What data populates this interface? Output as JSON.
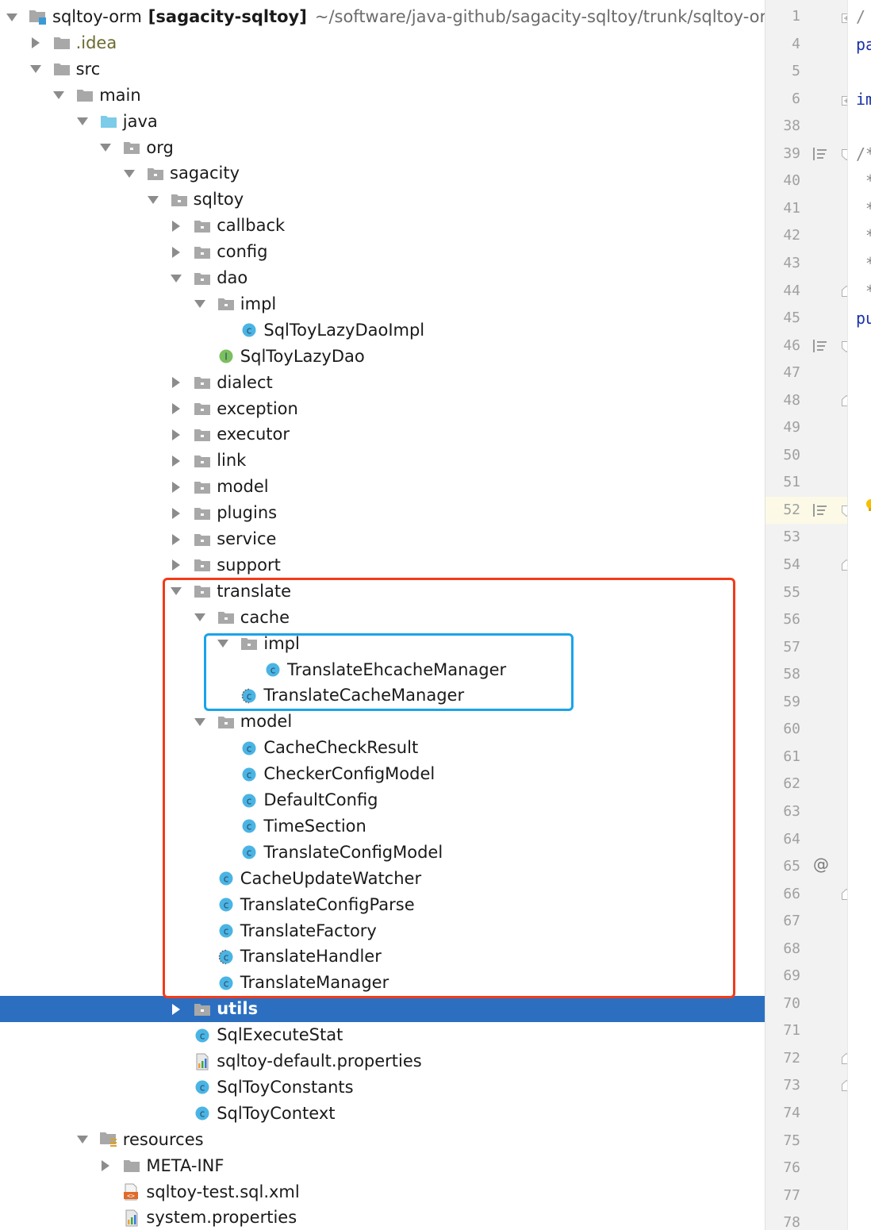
{
  "project": {
    "name": "sqltoy-orm",
    "module": "[sagacity-sqltoy]",
    "path": "~/software/java-github/sagacity-sqltoy/trunk/sqltoy-orm"
  },
  "tree": [
    {
      "label": "sqltoy-orm",
      "level": 0,
      "arrow": "down",
      "icon": "module-folder",
      "root": true
    },
    {
      "label": ".idea",
      "level": 1,
      "arrow": "right",
      "icon": "folder",
      "style": "idea"
    },
    {
      "label": "src",
      "level": 1,
      "arrow": "down",
      "icon": "folder"
    },
    {
      "label": "main",
      "level": 2,
      "arrow": "down",
      "icon": "folder"
    },
    {
      "label": "java",
      "level": 3,
      "arrow": "down",
      "icon": "source-folder"
    },
    {
      "label": "org",
      "level": 4,
      "arrow": "down",
      "icon": "package"
    },
    {
      "label": "sagacity",
      "level": 5,
      "arrow": "down",
      "icon": "package"
    },
    {
      "label": "sqltoy",
      "level": 6,
      "arrow": "down",
      "icon": "package"
    },
    {
      "label": "callback",
      "level": 7,
      "arrow": "right",
      "icon": "package"
    },
    {
      "label": "config",
      "level": 7,
      "arrow": "right",
      "icon": "package"
    },
    {
      "label": "dao",
      "level": 7,
      "arrow": "down",
      "icon": "package"
    },
    {
      "label": "impl",
      "level": 8,
      "arrow": "down",
      "icon": "package"
    },
    {
      "label": "SqlToyLazyDaoImpl",
      "level": 9,
      "arrow": "none",
      "icon": "class"
    },
    {
      "label": "SqlToyLazyDao",
      "level": 8,
      "arrow": "none",
      "icon": "interface"
    },
    {
      "label": "dialect",
      "level": 7,
      "arrow": "right",
      "icon": "package"
    },
    {
      "label": "exception",
      "level": 7,
      "arrow": "right",
      "icon": "package"
    },
    {
      "label": "executor",
      "level": 7,
      "arrow": "right",
      "icon": "package"
    },
    {
      "label": "link",
      "level": 7,
      "arrow": "right",
      "icon": "package"
    },
    {
      "label": "model",
      "level": 7,
      "arrow": "right",
      "icon": "package"
    },
    {
      "label": "plugins",
      "level": 7,
      "arrow": "right",
      "icon": "package"
    },
    {
      "label": "service",
      "level": 7,
      "arrow": "right",
      "icon": "package"
    },
    {
      "label": "support",
      "level": 7,
      "arrow": "right",
      "icon": "package"
    },
    {
      "label": "translate",
      "level": 7,
      "arrow": "down",
      "icon": "package"
    },
    {
      "label": "cache",
      "level": 8,
      "arrow": "down",
      "icon": "package"
    },
    {
      "label": "impl",
      "level": 9,
      "arrow": "down",
      "icon": "package"
    },
    {
      "label": "TranslateEhcacheManager",
      "level": 10,
      "arrow": "none",
      "icon": "class"
    },
    {
      "label": "TranslateCacheManager",
      "level": 9,
      "arrow": "none",
      "icon": "abstract-class"
    },
    {
      "label": "model",
      "level": 8,
      "arrow": "down",
      "icon": "package"
    },
    {
      "label": "CacheCheckResult",
      "level": 9,
      "arrow": "none",
      "icon": "class"
    },
    {
      "label": "CheckerConfigModel",
      "level": 9,
      "arrow": "none",
      "icon": "class"
    },
    {
      "label": "DefaultConfig",
      "level": 9,
      "arrow": "none",
      "icon": "class"
    },
    {
      "label": "TimeSection",
      "level": 9,
      "arrow": "none",
      "icon": "class"
    },
    {
      "label": "TranslateConfigModel",
      "level": 9,
      "arrow": "none",
      "icon": "class"
    },
    {
      "label": "CacheUpdateWatcher",
      "level": 8,
      "arrow": "none",
      "icon": "class"
    },
    {
      "label": "TranslateConfigParse",
      "level": 8,
      "arrow": "none",
      "icon": "class"
    },
    {
      "label": "TranslateFactory",
      "level": 8,
      "arrow": "none",
      "icon": "class"
    },
    {
      "label": "TranslateHandler",
      "level": 8,
      "arrow": "none",
      "icon": "abstract-class"
    },
    {
      "label": "TranslateManager",
      "level": 8,
      "arrow": "none",
      "icon": "class"
    },
    {
      "label": "utils",
      "level": 7,
      "arrow": "right",
      "icon": "package",
      "selected": true
    },
    {
      "label": "SqlExecuteStat",
      "level": 7,
      "arrow": "none",
      "icon": "class"
    },
    {
      "label": "sqltoy-default.properties",
      "level": 7,
      "arrow": "none",
      "icon": "properties"
    },
    {
      "label": "SqlToyConstants",
      "level": 7,
      "arrow": "none",
      "icon": "class"
    },
    {
      "label": "SqlToyContext",
      "level": 7,
      "arrow": "none",
      "icon": "class"
    },
    {
      "label": "resources",
      "level": 3,
      "arrow": "down",
      "icon": "resources-folder"
    },
    {
      "label": "META-INF",
      "level": 4,
      "arrow": "right",
      "icon": "folder"
    },
    {
      "label": "sqltoy-test.sql.xml",
      "level": 4,
      "arrow": "none",
      "icon": "xml"
    },
    {
      "label": "system.properties",
      "level": 4,
      "arrow": "none",
      "icon": "properties"
    }
  ],
  "gutter": {
    "line_numbers": [
      "1",
      "4",
      "5",
      "6",
      "38",
      "39",
      "40",
      "41",
      "42",
      "43",
      "44",
      "45",
      "46",
      "47",
      "48",
      "49",
      "50",
      "51",
      "52",
      "53",
      "54",
      "55",
      "56",
      "57",
      "58",
      "59",
      "60",
      "61",
      "62",
      "63",
      "64",
      "65",
      "66",
      "67",
      "68",
      "69",
      "70",
      "71",
      "72",
      "73",
      "74",
      "75",
      "76",
      "77",
      "78"
    ],
    "highlighted_line": "52",
    "annotation_symbol": "@",
    "annotation_line": "65"
  },
  "editor": {
    "lines": [
      {
        "line": "1",
        "text": "/",
        "kind": "comment"
      },
      {
        "line": "4",
        "text": "pa",
        "kind": "keyword"
      },
      {
        "line": "6",
        "text": "im",
        "kind": "keyword"
      },
      {
        "line": "39",
        "text": "/*",
        "kind": "comment"
      },
      {
        "line": "40",
        "text": "*",
        "kind": "comment"
      },
      {
        "line": "41",
        "text": "*",
        "kind": "comment"
      },
      {
        "line": "42",
        "text": "*",
        "kind": "comment"
      },
      {
        "line": "43",
        "text": "*",
        "kind": "comment"
      },
      {
        "line": "44",
        "text": "*",
        "kind": "comment"
      },
      {
        "line": "45",
        "text": "pu",
        "kind": "keyword"
      }
    ]
  },
  "highlights": [
    {
      "name": "translate-package-highlight",
      "color": "#f23b1a"
    },
    {
      "name": "cache-impl-highlight",
      "color": "#1aa3ea"
    }
  ],
  "colors": {
    "selection": "#2c6fc1",
    "class_icon": "#4ab4e4",
    "interface_icon": "#7bbf5f",
    "folder_icon": "#a8a8a8",
    "source_folder_icon": "#7ccbe8"
  }
}
